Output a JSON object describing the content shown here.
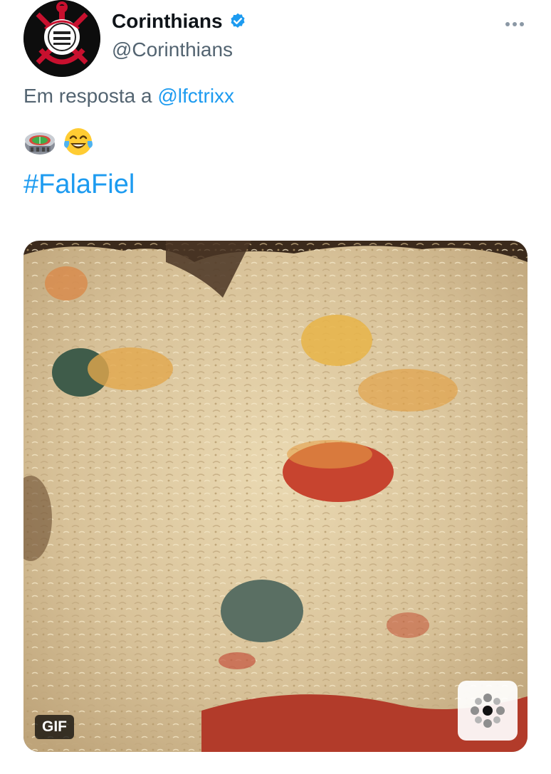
{
  "tweet": {
    "author": {
      "display_name": "Corinthians",
      "handle": "@Corinthians",
      "avatar_icon": "corinthians-crest-icon",
      "verified_icon": "verified-badge-icon"
    },
    "more_icon": "more-options-icon",
    "reply_context": {
      "prefix": "Em resposta a",
      "mention": "@lfctrixx"
    },
    "emojis": [
      "stadium-emoji",
      "tears-of-joy-emoji"
    ],
    "hashtag": "#FalaFiel",
    "media": {
      "type": "gif",
      "badge": "GIF",
      "watermark_icon": "gif-provider-logo-icon"
    }
  },
  "colors": {
    "link": "#1d9bf0",
    "secondary_text": "#536471",
    "primary_text": "#0f1419",
    "verified": "#1d9bf0"
  }
}
